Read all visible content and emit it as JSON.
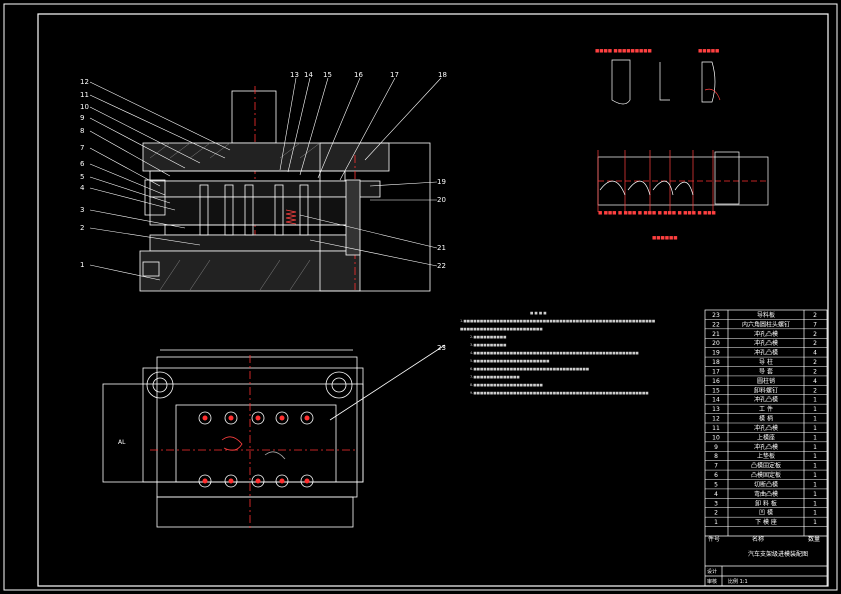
{
  "colors": {
    "background": "#000000",
    "line": "#ffffff",
    "center_line": "#ff3030",
    "accent_red": "#ff4040"
  },
  "callouts_left": [
    "12",
    "11",
    "10",
    "9",
    "8",
    "7",
    "6",
    "5",
    "4",
    "3",
    "2",
    "1"
  ],
  "callouts_top": [
    "13",
    "14",
    "15",
    "16",
    "17",
    "18"
  ],
  "callouts_right": [
    "19",
    "20",
    "21",
    "22"
  ],
  "callout_plan": "23",
  "dim_al": "AL",
  "bom": {
    "rows": [
      [
        "23",
        "导料板",
        "2"
      ],
      [
        "22",
        "内六角圆柱头螺钉",
        "7"
      ],
      [
        "21",
        "冲孔凸模",
        "2"
      ],
      [
        "20",
        "冲孔凸模",
        "2"
      ],
      [
        "19",
        "冲孔凸模",
        "4"
      ],
      [
        "18",
        "导  柱",
        "2"
      ],
      [
        "17",
        "导  套",
        "2"
      ],
      [
        "16",
        "圆柱销",
        "4"
      ],
      [
        "15",
        "卸料螺钉",
        "2"
      ],
      [
        "14",
        "冲孔凸模",
        "1"
      ],
      [
        "13",
        "工  件",
        "1"
      ],
      [
        "12",
        "模  柄",
        "1"
      ],
      [
        "11",
        "冲孔凸模",
        "1"
      ],
      [
        "10",
        "上模座",
        "1"
      ],
      [
        "9",
        "冲孔凸模",
        "1"
      ],
      [
        "8",
        "上垫板",
        "1"
      ],
      [
        "7",
        "凸模固定板",
        "1"
      ],
      [
        "6",
        "凸模固定板",
        "1"
      ],
      [
        "5",
        "切断凸模",
        "1"
      ],
      [
        "4",
        "弯曲凸模",
        "1"
      ],
      [
        "3",
        "卸 料 板",
        "1"
      ],
      [
        "2",
        "凹  模",
        "1"
      ],
      [
        "1",
        "下 模 座",
        "1"
      ]
    ],
    "header": [
      "件号",
      "名称",
      "数量"
    ],
    "title": "汽车支架级进模装配图",
    "sign_1": "设计",
    "sign_2": "审核",
    "sign_3": "比例 1:1"
  }
}
